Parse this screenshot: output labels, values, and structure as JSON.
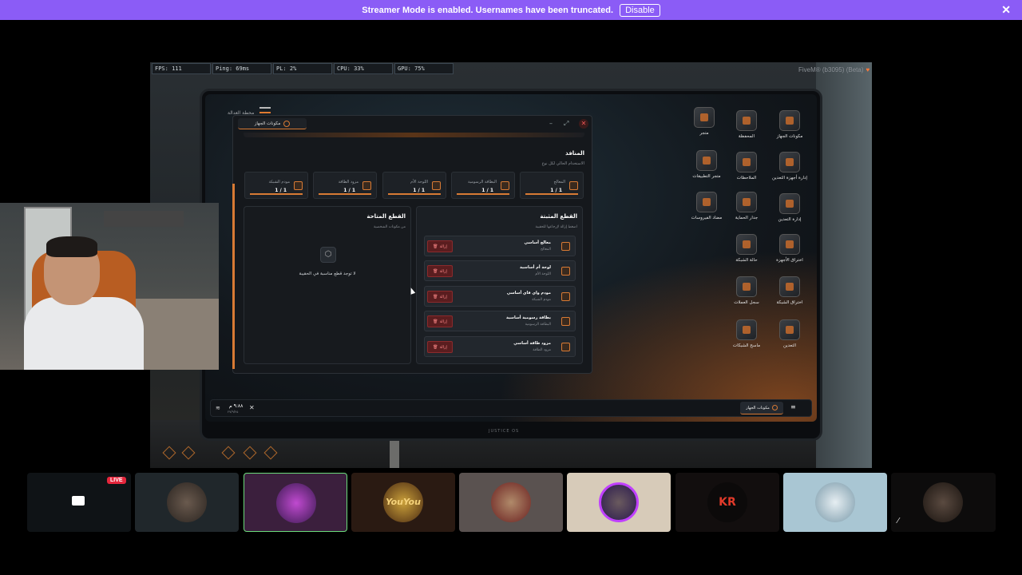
{
  "banner": {
    "message": "Streamer Mode is enabled. Usernames have been truncated.",
    "disable_label": "Disable",
    "close": "✕"
  },
  "perf": {
    "fps": "FPS: 111",
    "ping": "Ping: 69ms",
    "pl": "PL: 2%",
    "cpu": "CPU: 33%",
    "gpu": "GPU: 75%"
  },
  "fivem_label": "FiveM® (b3095) (Beta)",
  "tablet": {
    "brand": "محطة العدالة",
    "footer_brand": "JUSTICE OS"
  },
  "desktop_icons": [
    {
      "label": "مكونات الجهاز"
    },
    {
      "label": "المحفظة"
    },
    {
      "label": "متجر"
    },
    {
      "label": "إدارة أجهزة التعدين"
    },
    {
      "label": "الملاحظات"
    },
    {
      "label": "متجر التطبيقات"
    },
    {
      "label": "إدارة التعدين"
    },
    {
      "label": "جدار الحماية"
    },
    {
      "label": "مضاد الفيروسات"
    },
    {
      "label": "اختراق الأجهزة"
    },
    {
      "label": "حالة الشبكة"
    },
    {
      "label": "اختراق الشبكة"
    },
    {
      "label": "سجل العملات"
    },
    {
      "label": "التعدين"
    },
    {
      "label": "ماسح الشبكات"
    }
  ],
  "window": {
    "title": "مكونات الجهاز",
    "minimize": "–",
    "maximize": "⤢",
    "close": "✕",
    "ports_title": "المنافذ",
    "ports_sub": "الاستخدام الحالي لكل نوع",
    "slots": [
      {
        "name": "المعالج",
        "value": "1 / 1"
      },
      {
        "name": "البطاقة الرسومية",
        "value": "1 / 1"
      },
      {
        "name": "اللوحة الأم",
        "value": "1 / 1"
      },
      {
        "name": "مزود الطاقة",
        "value": "1 / 1"
      },
      {
        "name": "مودم الشبكة",
        "value": "1 / 1"
      }
    ],
    "installed_title": "القطع المثبتة",
    "installed_sub": "اضغط إزالة لإرجاعها للحقيبة",
    "available_title": "القطع المتاحة",
    "available_sub": "من مكونات الشخصية",
    "remove_label": "إزالة",
    "parts": [
      {
        "name": "معالج أساسي",
        "type": "المعالج"
      },
      {
        "name": "لوحة أم أساسية",
        "type": "اللوحة الأم"
      },
      {
        "name": "مودم واي فاي أساسي",
        "type": "مودم الشبكة"
      },
      {
        "name": "بطاقة رسومية أساسية",
        "type": "البطاقة الرسومية"
      },
      {
        "name": "مزود طاقة أساسي",
        "type": "مزود الطاقة"
      }
    ],
    "empty_icon": "⬡",
    "empty_text": "لا توجد قطع مناسبة في الحقيبة"
  },
  "taskbar": {
    "time": "٩:٨٨ م",
    "date": "٢٧/٩/٢٥",
    "close": "✕",
    "wifi": "≋",
    "app_label": "مكونات الجهاز",
    "menu": "≡"
  },
  "stream": {
    "live_label": "LIVE",
    "yoyou": "YouYou",
    "kr": "KR"
  },
  "colors": {
    "accent": "#d87a34",
    "banner": "#8b5cf6",
    "live": "#e5263c",
    "danger": "#8b2a2c"
  }
}
